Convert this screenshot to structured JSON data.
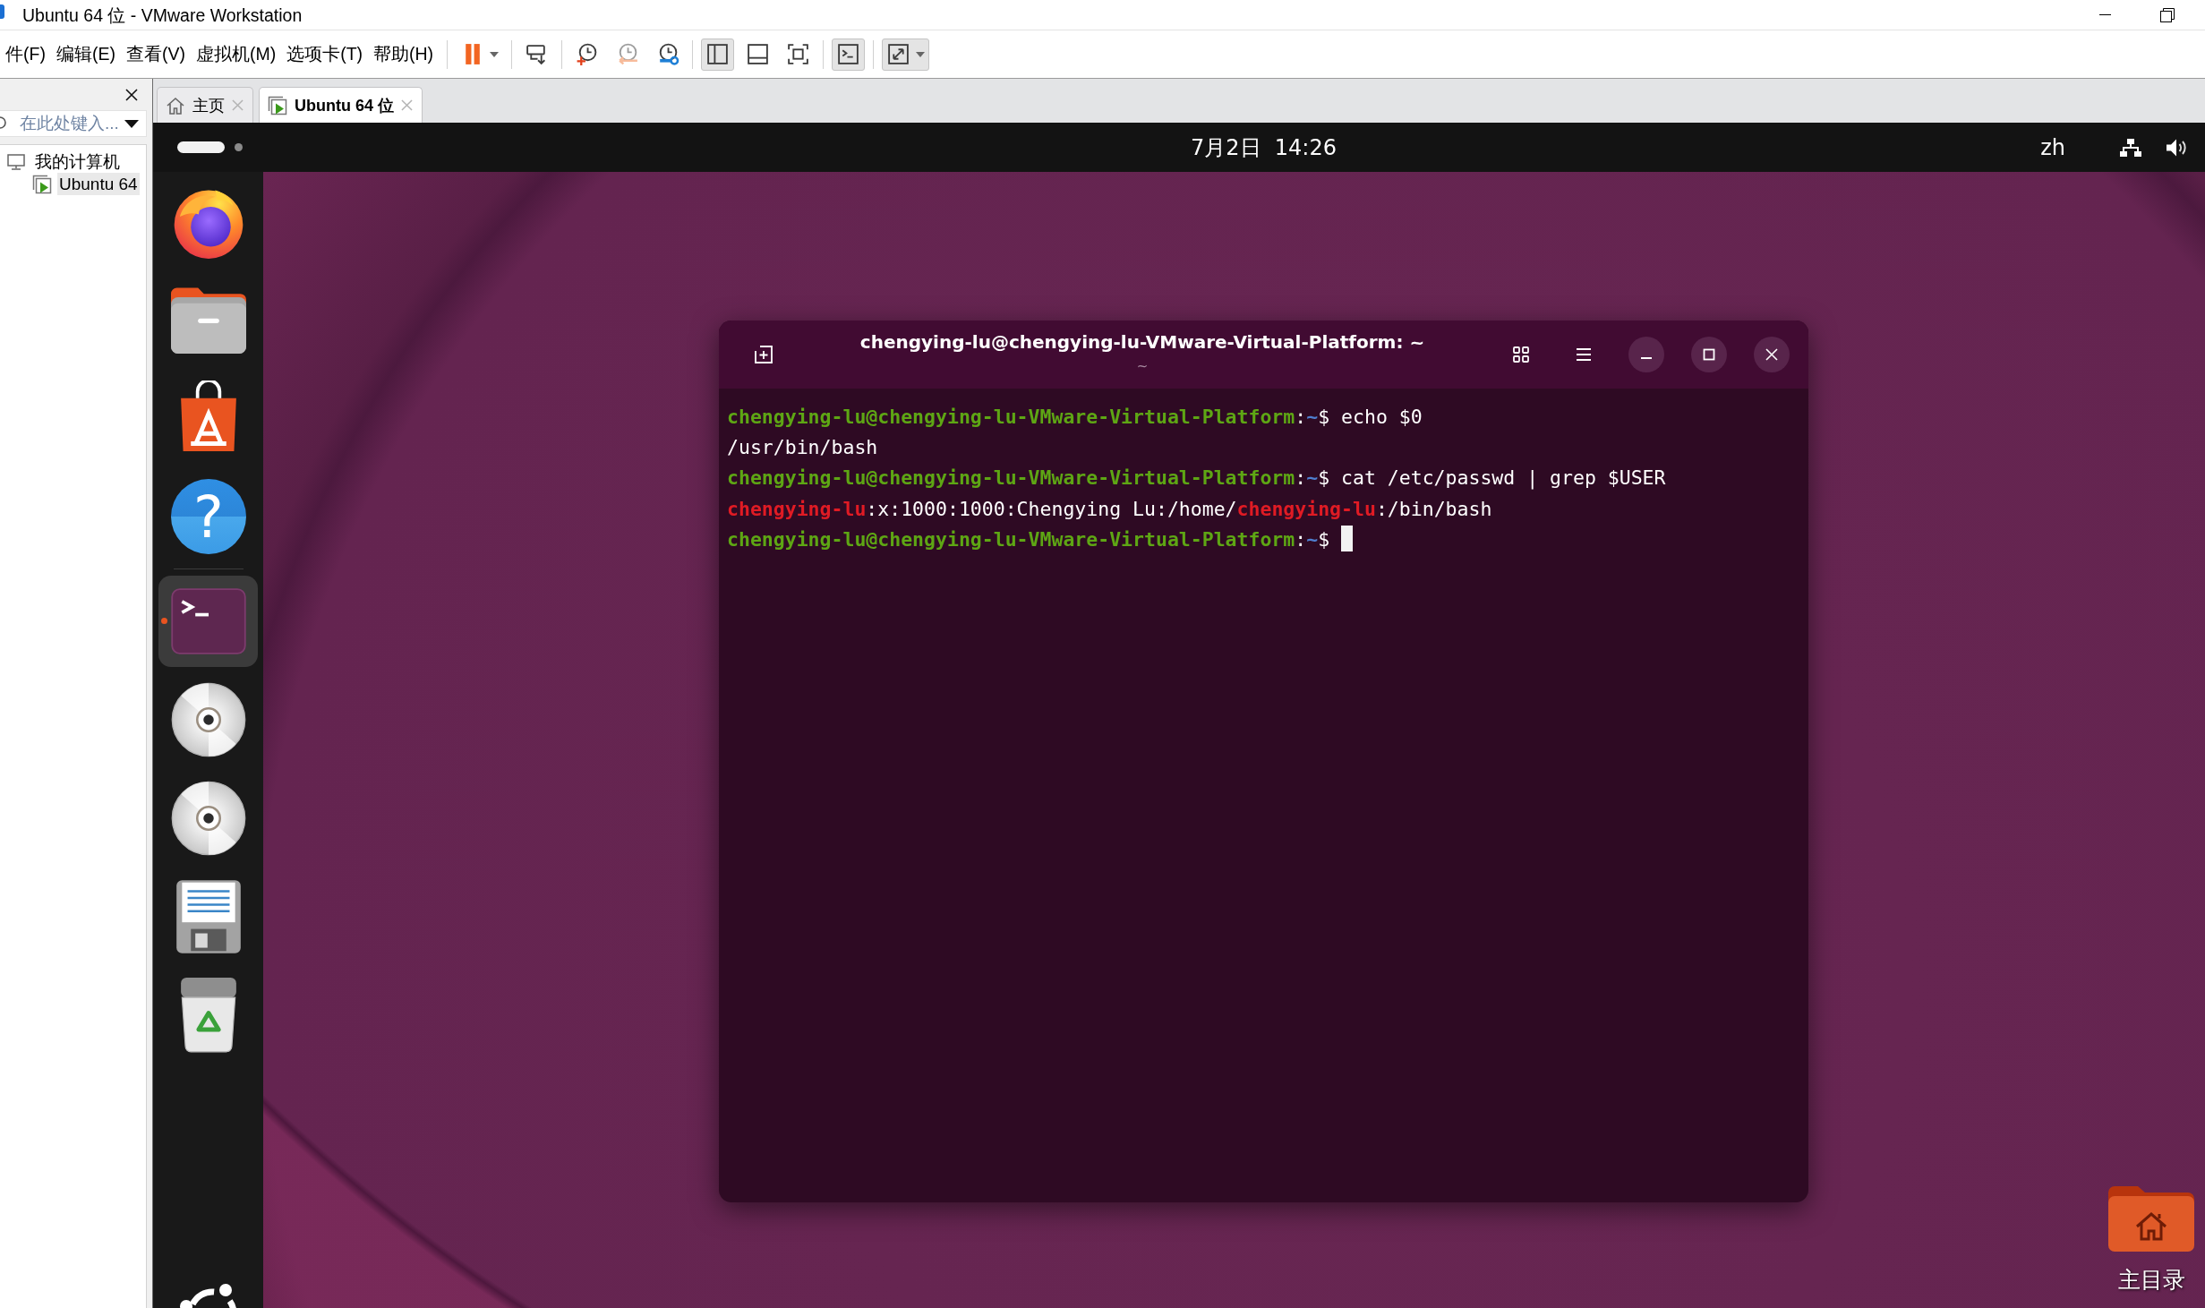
{
  "window": {
    "title": "Ubuntu 64 位 - VMware Workstation"
  },
  "menu_bar": [
    "件(F)",
    "编辑(E)",
    "查看(V)",
    "虚拟机(M)",
    "选项卡(T)",
    "帮助(H)"
  ],
  "toolbar": [
    {
      "items": [
        {
          "kind": "pause",
          "pressed": false,
          "disabled": false,
          "dropdown": true
        }
      ]
    },
    {
      "items": [
        {
          "kind": "send_keys",
          "pressed": false,
          "disabled": false,
          "dropdown": false
        }
      ]
    },
    {
      "items": [
        {
          "kind": "snapshot_take",
          "pressed": false,
          "disabled": false,
          "dropdown": false
        },
        {
          "kind": "snapshot_revert",
          "pressed": false,
          "disabled": true,
          "dropdown": false
        },
        {
          "kind": "snapshot_manager",
          "pressed": false,
          "disabled": false,
          "dropdown": false
        }
      ]
    },
    {
      "items": [
        {
          "kind": "view_library",
          "pressed": true,
          "disabled": false,
          "dropdown": false
        },
        {
          "kind": "view_thumbnails",
          "pressed": false,
          "disabled": false,
          "dropdown": false
        },
        {
          "kind": "view_fit",
          "pressed": false,
          "disabled": false,
          "dropdown": false
        }
      ]
    },
    {
      "items": [
        {
          "kind": "console",
          "pressed": true,
          "disabled": false,
          "dropdown": false
        }
      ]
    },
    {
      "items": [
        {
          "kind": "fullscreen",
          "pressed": true,
          "disabled": false,
          "dropdown": true
        }
      ]
    }
  ],
  "library": {
    "search": {
      "placeholder": "在此处键入..."
    },
    "tree": [
      {
        "label": "我的计算机",
        "kind": "computer",
        "selected": false,
        "children": [
          {
            "label": "Ubuntu 64",
            "kind": "vm",
            "selected": true
          }
        ]
      }
    ]
  },
  "tabs": [
    {
      "label": "主页",
      "kind": "home",
      "selected": false
    },
    {
      "label": "Ubuntu 64 位",
      "kind": "vm",
      "selected": true
    }
  ],
  "guest": {
    "top_bar": {
      "workspaces": [
        {
          "selected": true
        },
        {
          "selected": false
        }
      ],
      "clock": "7月2日  14:26",
      "input_method": "zh"
    },
    "dock": {
      "pinned": [
        {
          "kind": "browser",
          "running": false,
          "focused": false
        },
        {
          "kind": "files",
          "running": false,
          "focused": false
        },
        {
          "kind": "appstore",
          "running": false,
          "focused": false
        },
        {
          "kind": "help",
          "glyph": "?",
          "running": false,
          "focused": false
        }
      ],
      "other": [
        {
          "kind": "terminal",
          "running": true,
          "focused": true
        },
        {
          "kind": "disc",
          "running": false,
          "focused": false
        },
        {
          "kind": "disc",
          "running": false,
          "focused": false
        },
        {
          "kind": "document",
          "running": false,
          "focused": false
        },
        {
          "kind": "trash",
          "running": false,
          "focused": false
        }
      ]
    },
    "terminal": {
      "title": "chengying-lu@chengying-lu-VMware-Virtual-Platform: ~",
      "subtitle": "~",
      "lines": [
        {
          "cursor": false,
          "segments": [
            {
              "kind": "prompt",
              "text": "chengying-lu@chengying-lu-VMware-Virtual-Platform"
            },
            {
              "kind": "plain",
              "text": ":"
            },
            {
              "kind": "path",
              "text": "~"
            },
            {
              "kind": "plain",
              "text": "$ echo $0"
            }
          ]
        },
        {
          "cursor": false,
          "segments": [
            {
              "kind": "plain",
              "text": "/usr/bin/bash"
            }
          ]
        },
        {
          "cursor": false,
          "segments": [
            {
              "kind": "prompt",
              "text": "chengying-lu@chengying-lu-VMware-Virtual-Platform"
            },
            {
              "kind": "plain",
              "text": ":"
            },
            {
              "kind": "path",
              "text": "~"
            },
            {
              "kind": "plain",
              "text": "$ cat /etc/passwd | grep $USER"
            }
          ]
        },
        {
          "cursor": false,
          "segments": [
            {
              "kind": "match",
              "text": "chengying-lu"
            },
            {
              "kind": "plain",
              "text": ":x:1000:1000:Chengying Lu:/home/"
            },
            {
              "kind": "match",
              "text": "chengying-lu"
            },
            {
              "kind": "plain",
              "text": ":/bin/bash"
            }
          ]
        },
        {
          "cursor": true,
          "segments": [
            {
              "kind": "prompt",
              "text": "chengying-lu@chengying-lu-VMware-Virtual-Platform"
            },
            {
              "kind": "plain",
              "text": ":"
            },
            {
              "kind": "path",
              "text": "~"
            },
            {
              "kind": "plain",
              "text": "$ "
            }
          ]
        }
      ]
    },
    "desktop_icons": [
      {
        "label": "主目录",
        "kind": "home_folder"
      }
    ]
  }
}
